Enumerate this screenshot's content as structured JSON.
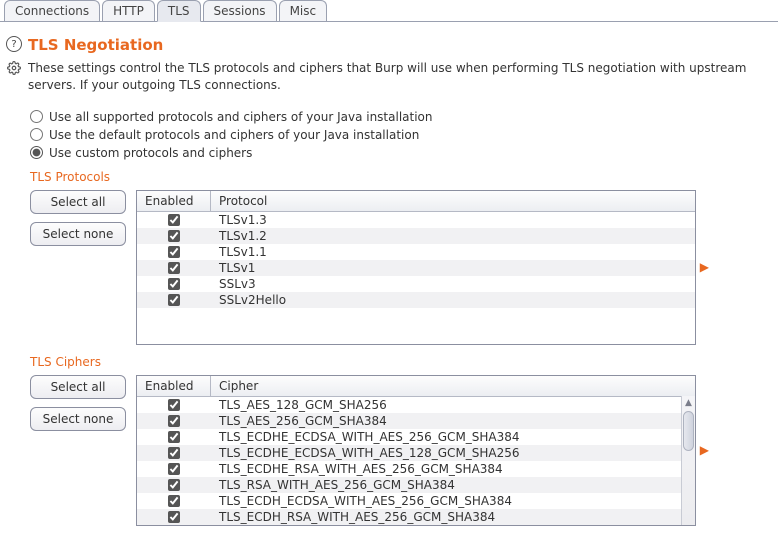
{
  "tabs": [
    {
      "label": "Connections",
      "selected": false
    },
    {
      "label": "HTTP",
      "selected": false
    },
    {
      "label": "TLS",
      "selected": true
    },
    {
      "label": "Sessions",
      "selected": false
    },
    {
      "label": "Misc",
      "selected": false
    }
  ],
  "section": {
    "title": "TLS Negotiation",
    "description": "These settings control the TLS protocols and ciphers that Burp will use when performing TLS negotiation with upstream servers. If your outgoing TLS connections."
  },
  "radios": [
    {
      "label": "Use all supported protocols and ciphers of your Java installation",
      "checked": false
    },
    {
      "label": "Use the default protocols and ciphers of your Java installation",
      "checked": false
    },
    {
      "label": "Use custom protocols and ciphers",
      "checked": true
    }
  ],
  "protocols": {
    "heading": "TLS Protocols",
    "select_all": "Select all",
    "select_none": "Select none",
    "columns": {
      "enabled": "Enabled",
      "protocol": "Protocol"
    },
    "rows": [
      {
        "enabled": true,
        "protocol": "TLSv1.3"
      },
      {
        "enabled": true,
        "protocol": "TLSv1.2"
      },
      {
        "enabled": true,
        "protocol": "TLSv1.1"
      },
      {
        "enabled": true,
        "protocol": "TLSv1"
      },
      {
        "enabled": true,
        "protocol": "SSLv3"
      },
      {
        "enabled": true,
        "protocol": "SSLv2Hello"
      }
    ]
  },
  "ciphers": {
    "heading": "TLS Ciphers",
    "select_all": "Select all",
    "select_none": "Select none",
    "columns": {
      "enabled": "Enabled",
      "cipher": "Cipher"
    },
    "rows": [
      {
        "enabled": true,
        "cipher": "TLS_AES_128_GCM_SHA256"
      },
      {
        "enabled": true,
        "cipher": "TLS_AES_256_GCM_SHA384"
      },
      {
        "enabled": true,
        "cipher": "TLS_ECDHE_ECDSA_WITH_AES_256_GCM_SHA384"
      },
      {
        "enabled": true,
        "cipher": "TLS_ECDHE_ECDSA_WITH_AES_128_GCM_SHA256"
      },
      {
        "enabled": true,
        "cipher": "TLS_ECDHE_RSA_WITH_AES_256_GCM_SHA384"
      },
      {
        "enabled": true,
        "cipher": "TLS_RSA_WITH_AES_256_GCM_SHA384"
      },
      {
        "enabled": true,
        "cipher": "TLS_ECDH_ECDSA_WITH_AES_256_GCM_SHA384"
      },
      {
        "enabled": true,
        "cipher": "TLS_ECDH_RSA_WITH_AES_256_GCM_SHA384"
      }
    ]
  }
}
